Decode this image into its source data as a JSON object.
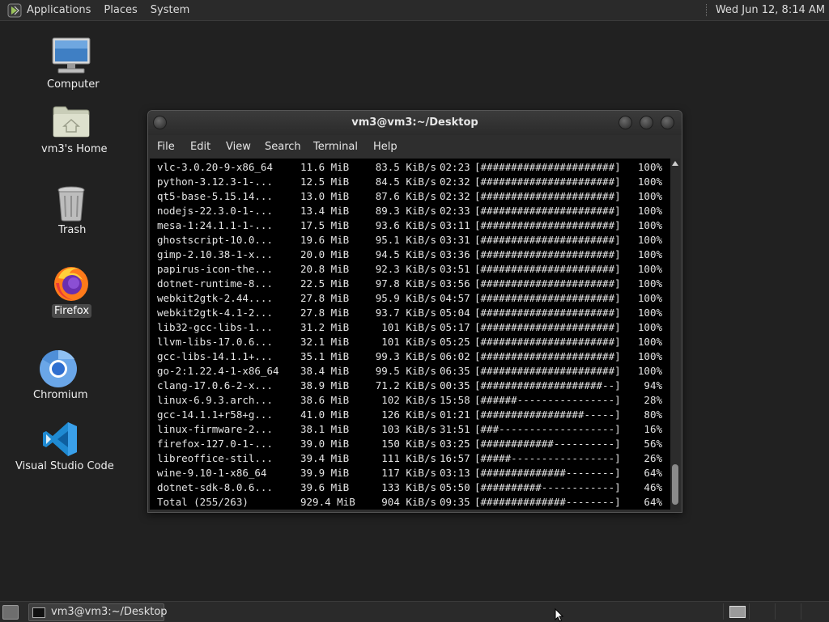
{
  "top_panel": {
    "menus": [
      "Applications",
      "Places",
      "System"
    ],
    "clock": "Wed Jun 12,  8:14 AM"
  },
  "desktop": {
    "icons": [
      {
        "label": "Computer",
        "icon": "computer-icon"
      },
      {
        "label": "vm3's Home",
        "icon": "home-folder-icon"
      },
      {
        "label": "Trash",
        "icon": "trash-icon"
      },
      {
        "label": "Firefox",
        "icon": "firefox-icon"
      },
      {
        "label": "Chromium",
        "icon": "chromium-icon"
      },
      {
        "label": "Visual Studio Code",
        "icon": "vscode-icon"
      }
    ]
  },
  "terminal": {
    "title": "vm3@vm3:~/Desktop",
    "menu": [
      "File",
      "Edit",
      "View",
      "Search",
      "Terminal",
      "Help"
    ],
    "rows": [
      {
        "name": "vlc-3.0.20-9-x86_64",
        "size": "11.6 MiB",
        "rate": "83.5 KiB/s",
        "time": "02:23",
        "bar": "[######################]",
        "pct": "100%"
      },
      {
        "name": "python-3.12.3-1-...",
        "size": "12.5 MiB",
        "rate": "84.5 KiB/s",
        "time": "02:32",
        "bar": "[######################]",
        "pct": "100%"
      },
      {
        "name": "qt5-base-5.15.14...",
        "size": "13.0 MiB",
        "rate": "87.6 KiB/s",
        "time": "02:32",
        "bar": "[######################]",
        "pct": "100%"
      },
      {
        "name": "nodejs-22.3.0-1-...",
        "size": "13.4 MiB",
        "rate": "89.3 KiB/s",
        "time": "02:33",
        "bar": "[######################]",
        "pct": "100%"
      },
      {
        "name": "mesa-1:24.1.1-1-...",
        "size": "17.5 MiB",
        "rate": "93.6 KiB/s",
        "time": "03:11",
        "bar": "[######################]",
        "pct": "100%"
      },
      {
        "name": "ghostscript-10.0...",
        "size": "19.6 MiB",
        "rate": "95.1 KiB/s",
        "time": "03:31",
        "bar": "[######################]",
        "pct": "100%"
      },
      {
        "name": "gimp-2.10.38-1-x...",
        "size": "20.0 MiB",
        "rate": "94.5 KiB/s",
        "time": "03:36",
        "bar": "[######################]",
        "pct": "100%"
      },
      {
        "name": "papirus-icon-the...",
        "size": "20.8 MiB",
        "rate": "92.3 KiB/s",
        "time": "03:51",
        "bar": "[######################]",
        "pct": "100%"
      },
      {
        "name": "dotnet-runtime-8...",
        "size": "22.5 MiB",
        "rate": "97.8 KiB/s",
        "time": "03:56",
        "bar": "[######################]",
        "pct": "100%"
      },
      {
        "name": "webkit2gtk-2.44....",
        "size": "27.8 MiB",
        "rate": "95.9 KiB/s",
        "time": "04:57",
        "bar": "[######################]",
        "pct": "100%"
      },
      {
        "name": "webkit2gtk-4.1-2...",
        "size": "27.8 MiB",
        "rate": "93.7 KiB/s",
        "time": "05:04",
        "bar": "[######################]",
        "pct": "100%"
      },
      {
        "name": "lib32-gcc-libs-1...",
        "size": "31.2 MiB",
        "rate": "101 KiB/s",
        "time": "05:17",
        "bar": "[######################]",
        "pct": "100%"
      },
      {
        "name": "llvm-libs-17.0.6...",
        "size": "32.1 MiB",
        "rate": "101 KiB/s",
        "time": "05:25",
        "bar": "[######################]",
        "pct": "100%"
      },
      {
        "name": "gcc-libs-14.1.1+...",
        "size": "35.1 MiB",
        "rate": "99.3 KiB/s",
        "time": "06:02",
        "bar": "[######################]",
        "pct": "100%"
      },
      {
        "name": "go-2:1.22.4-1-x86_64",
        "size": "38.4 MiB",
        "rate": "99.5 KiB/s",
        "time": "06:35",
        "bar": "[######################]",
        "pct": "100%"
      },
      {
        "name": "clang-17.0.6-2-x...",
        "size": "38.9 MiB",
        "rate": "71.2 KiB/s",
        "time": "00:35",
        "bar": "[####################--]",
        "pct": "94%"
      },
      {
        "name": "linux-6.9.3.arch...",
        "size": "38.6 MiB",
        "rate": "102 KiB/s",
        "time": "15:58",
        "bar": "[######----------------]",
        "pct": "28%"
      },
      {
        "name": "gcc-14.1.1+r58+g...",
        "size": "41.0 MiB",
        "rate": "126 KiB/s",
        "time": "01:21",
        "bar": "[#################-----]",
        "pct": "80%"
      },
      {
        "name": "linux-firmware-2...",
        "size": "38.1 MiB",
        "rate": "103 KiB/s",
        "time": "31:51",
        "bar": "[###-------------------]",
        "pct": "16%"
      },
      {
        "name": "firefox-127.0-1-...",
        "size": "39.0 MiB",
        "rate": "150 KiB/s",
        "time": "03:25",
        "bar": "[############----------]",
        "pct": "56%"
      },
      {
        "name": "libreoffice-stil...",
        "size": "39.4 MiB",
        "rate": "111 KiB/s",
        "time": "16:57",
        "bar": "[#####-----------------]",
        "pct": "26%"
      },
      {
        "name": "wine-9.10-1-x86_64",
        "size": "39.9 MiB",
        "rate": "117 KiB/s",
        "time": "03:13",
        "bar": "[##############--------]",
        "pct": "64%"
      },
      {
        "name": "dotnet-sdk-8.0.6...",
        "size": "39.6 MiB",
        "rate": "133 KiB/s",
        "time": "05:50",
        "bar": "[##########------------]",
        "pct": "46%"
      },
      {
        "name": "Total (255/263)",
        "size": "929.4 MiB",
        "rate": "904 KiB/s",
        "time": "09:35",
        "bar": "[##############--------]",
        "pct": "64%"
      }
    ]
  },
  "bottom_panel": {
    "task_label": "vm3@vm3:~/Desktop"
  },
  "colors": {
    "desktop_bg": "#212121",
    "panel_bg": "#2a2a2a",
    "terminal_bg": "#000000",
    "terminal_fg": "#e4e4e4"
  }
}
